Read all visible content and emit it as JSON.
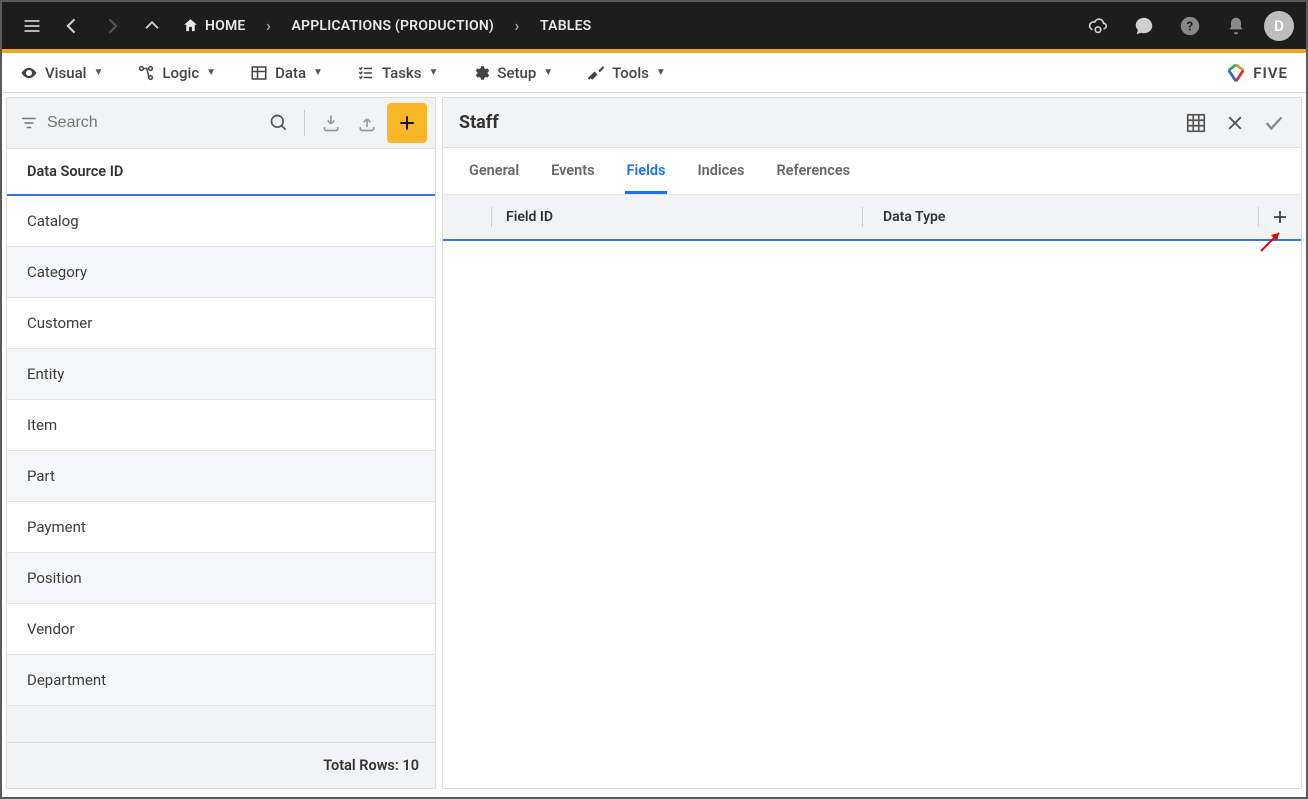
{
  "topbar": {
    "breadcrumb": {
      "home": "HOME",
      "apps": "APPLICATIONS (PRODUCTION)",
      "tables": "TABLES"
    },
    "avatar_initial": "D"
  },
  "menubar": {
    "visual": "Visual",
    "logic": "Logic",
    "data": "Data",
    "tasks": "Tasks",
    "setup": "Setup",
    "tools": "Tools",
    "brand": "FIVE"
  },
  "left": {
    "search_placeholder": "Search",
    "column_header": "Data Source ID",
    "rows": [
      "Catalog",
      "Category",
      "Customer",
      "Entity",
      "Item",
      "Part",
      "Payment",
      "Position",
      "Vendor",
      "Department"
    ],
    "total_label": "Total Rows: 10"
  },
  "right": {
    "title": "Staff",
    "tabs": {
      "general": "General",
      "events": "Events",
      "fields": "Fields",
      "indices": "Indices",
      "references": "References"
    },
    "field_headers": {
      "field_id": "Field ID",
      "data_type": "Data Type"
    }
  }
}
